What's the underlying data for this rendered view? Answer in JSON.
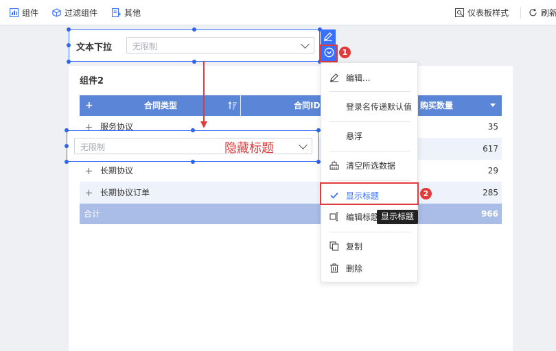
{
  "toolbar": {
    "left_items": [
      {
        "label": "组件",
        "icon": "component-icon"
      },
      {
        "label": "过滤组件",
        "icon": "filter-cube-icon"
      },
      {
        "label": "其他",
        "icon": "other-plus-icon"
      }
    ],
    "right_items": [
      {
        "label": "仪表板样式",
        "icon": "dashboard-style-icon"
      },
      {
        "label": "刷新",
        "icon": "refresh-icon"
      }
    ]
  },
  "filter_top": {
    "label": "文本下拉",
    "placeholder": "无限制"
  },
  "filter_hidden": {
    "placeholder": "无限制",
    "annotation": "隐藏标题"
  },
  "widget": {
    "title": "组件2"
  },
  "table": {
    "headers": {
      "plus": "+",
      "contract_type": "合同类型",
      "contract_id": "合同ID",
      "quantity": "购买数量"
    },
    "rows": [
      {
        "type": "服务协议",
        "qty": "35"
      },
      {
        "type": "",
        "qty": "617"
      },
      {
        "type": "长期协议",
        "qty": "29"
      },
      {
        "type": "长期协议订单",
        "qty": "285"
      }
    ],
    "total_label": "合计",
    "total_value": "966"
  },
  "menu": {
    "items": [
      {
        "label": "编辑...",
        "icon": "edit-pen-icon"
      },
      {
        "label": "登录名传递默认值",
        "icon": ""
      },
      {
        "label": "悬浮",
        "icon": ""
      },
      {
        "label": "清空所选数据",
        "icon": "clear-data-icon"
      },
      {
        "label": "显示标题",
        "icon": "check-icon",
        "checked": true
      },
      {
        "label": "编辑标题",
        "icon": "edit-title-icon"
      },
      {
        "label": "复制",
        "icon": "copy-icon"
      },
      {
        "label": "删除",
        "icon": "trash-icon"
      }
    ],
    "tooltip": "显示标题"
  },
  "badges": {
    "one": "1",
    "two": "2"
  },
  "colors": {
    "accent": "#3a70ff",
    "table_header": "#5b85d6",
    "total_row": "#a9bde6",
    "annotation": "#e03a3a"
  }
}
